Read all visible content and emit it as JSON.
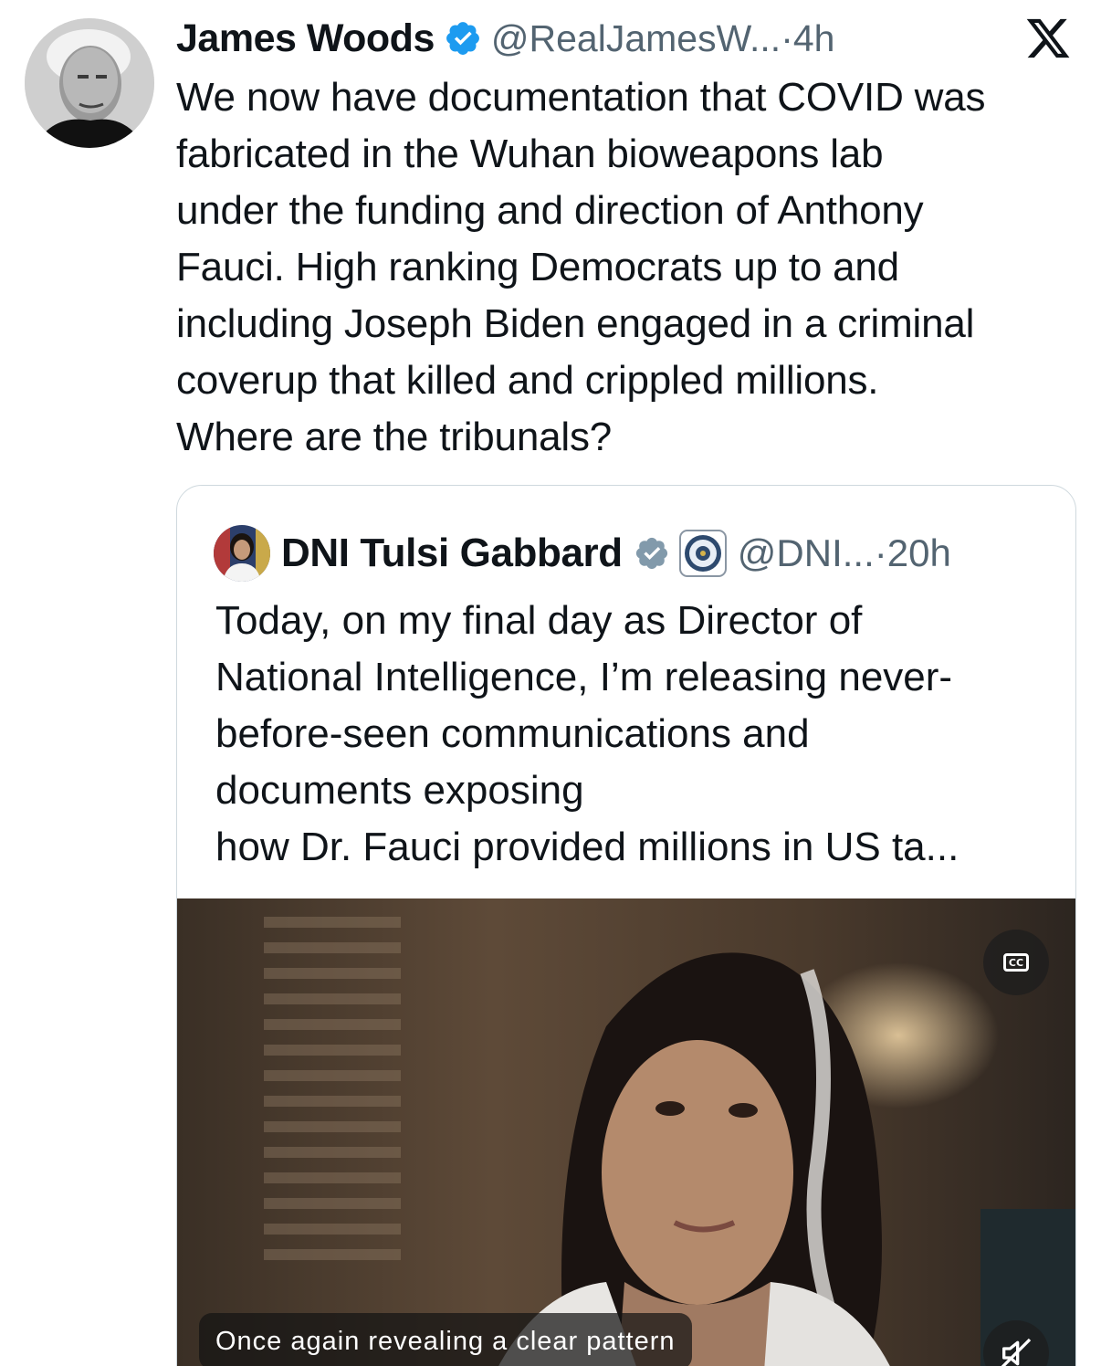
{
  "tweet": {
    "author_name": "James Woods",
    "handle": "@RealJamesW...",
    "separator": " · ",
    "time": "4h",
    "verified_icon": "verified-badge-icon",
    "text_lines": [
      "We now have documentation that COVID was",
      "fabricated in the Wuhan bioweapons lab",
      "under the funding and direction of Anthony",
      "Fauci. High ranking Democrats up to and",
      "including Joseph Biden engaged in a criminal",
      "coverup that killed and crippled millions.",
      "Where are the tribunals?"
    ]
  },
  "quote": {
    "author_name": "DNI Tulsi Gabbard",
    "handle": "@DNI...",
    "separator": " · ",
    "time": "20h",
    "text_lines": [
      "Today, on my final day as Director of",
      "National Intelligence, I’m releasing never-",
      "before-seen communications and",
      "documents exposing",
      "how Dr. Fauci provided millions in US ta..."
    ],
    "video": {
      "caption": "Once again revealing a clear pattern",
      "cc_label": "CC"
    }
  },
  "colors": {
    "text": "#0f1419",
    "secondary": "#536471",
    "verified": "#1d9bf0",
    "border": "#cfd9de"
  }
}
